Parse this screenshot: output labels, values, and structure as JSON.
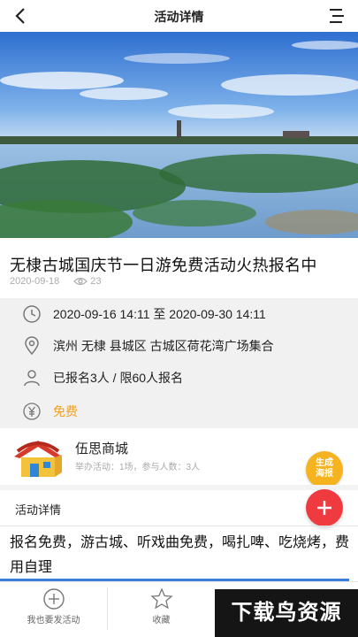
{
  "header": {
    "title": "活动详情"
  },
  "activity": {
    "title": "无棣古城国庆节一日游免费活动火热报名中",
    "date": "2020-09-18",
    "views": "23"
  },
  "info": {
    "time": "2020-09-16 14:11 至 2020-09-30 14:11",
    "location": "滨州 无棣 县城区 古城区荷花湾广场集合",
    "enroll": "已报名3人 / 限60人报名",
    "fee": "免费"
  },
  "store": {
    "name": "伍思商城",
    "stats": "举办活动：1场，参与人数：3人"
  },
  "poster_button": {
    "line1": "生成",
    "line2": "海报"
  },
  "detail": {
    "heading": "活动详情",
    "body": "报名免费，游古城、听戏曲免费，喝扎啤、吃烧烤，费用自理"
  },
  "tabbar": {
    "publish": "我也要发活动",
    "favorite": "收藏"
  },
  "watermark": "下载鸟资源",
  "colors": {
    "accent_orange": "#f0a020",
    "add_red": "#ef3a3f",
    "poster_yellow": "#f5b320"
  }
}
